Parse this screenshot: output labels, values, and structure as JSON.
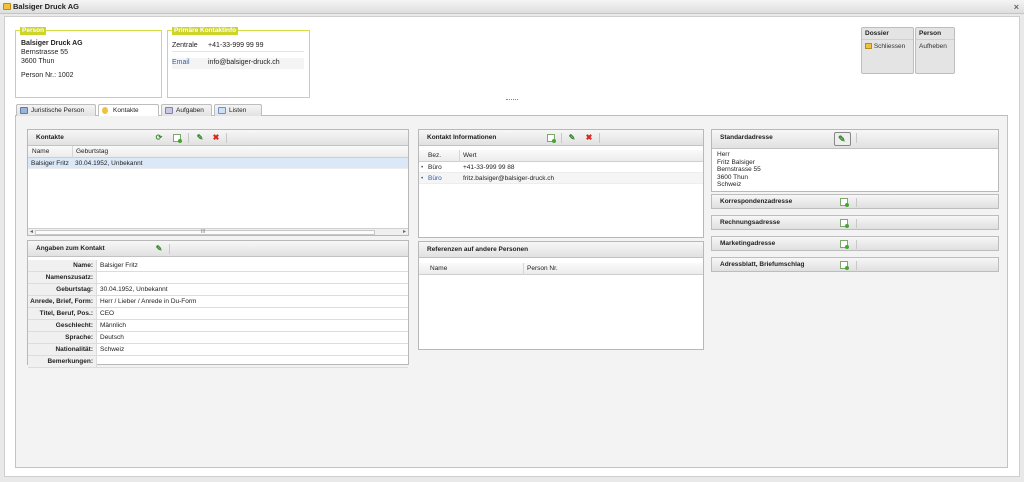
{
  "window": {
    "title": "Balsiger Druck AG",
    "close": "×"
  },
  "person_box": {
    "legend": "Person",
    "company": "Balsiger Druck AG",
    "street": "Bernstrasse 55",
    "city": "3600 Thun",
    "person_nr": "Person Nr.: 1002"
  },
  "contact_box": {
    "legend": "Primäre Kontaktinfo",
    "phone_label": "Zentrale",
    "phone_value": "+41-33-999 99 99",
    "email_label": "Email",
    "email_value": "info@balsiger-druck.ch"
  },
  "dossier": {
    "title": "Dossier",
    "action": "Schliessen"
  },
  "person_actions": {
    "title": "Person",
    "action": "Aufheben"
  },
  "tabs": [
    {
      "label": "Juristische Person"
    },
    {
      "label": "Kontakte"
    },
    {
      "label": "Aufgaben"
    },
    {
      "label": "Listen"
    }
  ],
  "kontakte": {
    "title": "Kontakte",
    "columns": [
      "Name",
      "Geburtstag"
    ],
    "rows": [
      {
        "name": "Balsiger Fritz",
        "birthday": "30.04.1952, Unbekannt"
      }
    ],
    "scroll_grip": "III"
  },
  "angaben": {
    "title": "Angaben zum Kontakt",
    "fields": [
      {
        "label": "Name:",
        "value": "Balsiger Fritz"
      },
      {
        "label": "Namenszusatz:",
        "value": ""
      },
      {
        "label": "Geburtstag:",
        "value": "30.04.1952, Unbekannt"
      },
      {
        "label": "Anrede, Brief, Form:",
        "value": "Herr / Lieber / Anrede in Du-Form"
      },
      {
        "label": "Titel, Beruf, Pos.:",
        "value": "CEO"
      },
      {
        "label": "Geschlecht:",
        "value": "Männlich"
      },
      {
        "label": "Sprache:",
        "value": "Deutsch"
      },
      {
        "label": "Nationalität:",
        "value": "Schweiz"
      },
      {
        "label": "Bemerkungen:",
        "value": ""
      }
    ]
  },
  "kontakt_info": {
    "title": "Kontakt Informationen",
    "columns": [
      "Bez.",
      "Wert"
    ],
    "rows": [
      {
        "bez": "Büro",
        "wert": "+41-33-999 99 88",
        "is_link": false
      },
      {
        "bez": "Büro",
        "wert": "fritz.balsiger@balsiger-druck.ch",
        "is_link": true
      }
    ]
  },
  "referenzen": {
    "title": "Referenzen auf andere Personen",
    "columns": [
      "Name",
      "Person Nr."
    ]
  },
  "standardadresse": {
    "title": "Standardadresse",
    "lines": [
      "Herr",
      "Fritz Balsiger",
      "Bernstrasse 55",
      "3600 Thun",
      "Schweiz"
    ]
  },
  "other_addresses": [
    {
      "title": "Korrespondenzadresse"
    },
    {
      "title": "Rechnungsadresse"
    },
    {
      "title": "Marketingadresse"
    },
    {
      "title": "Adressblatt, Briefumschlag"
    }
  ],
  "icons": {
    "new": "document-new-icon",
    "edit": "pencil-icon",
    "delete": "delete-x-icon",
    "refresh": "refresh-icon",
    "folder": "folder-icon"
  },
  "colors": {
    "accent": "#cdd628",
    "selection": "#dbe8f7",
    "link": "#2a5fb0",
    "delete": "#d7261d",
    "edit": "#3a8a2e"
  }
}
